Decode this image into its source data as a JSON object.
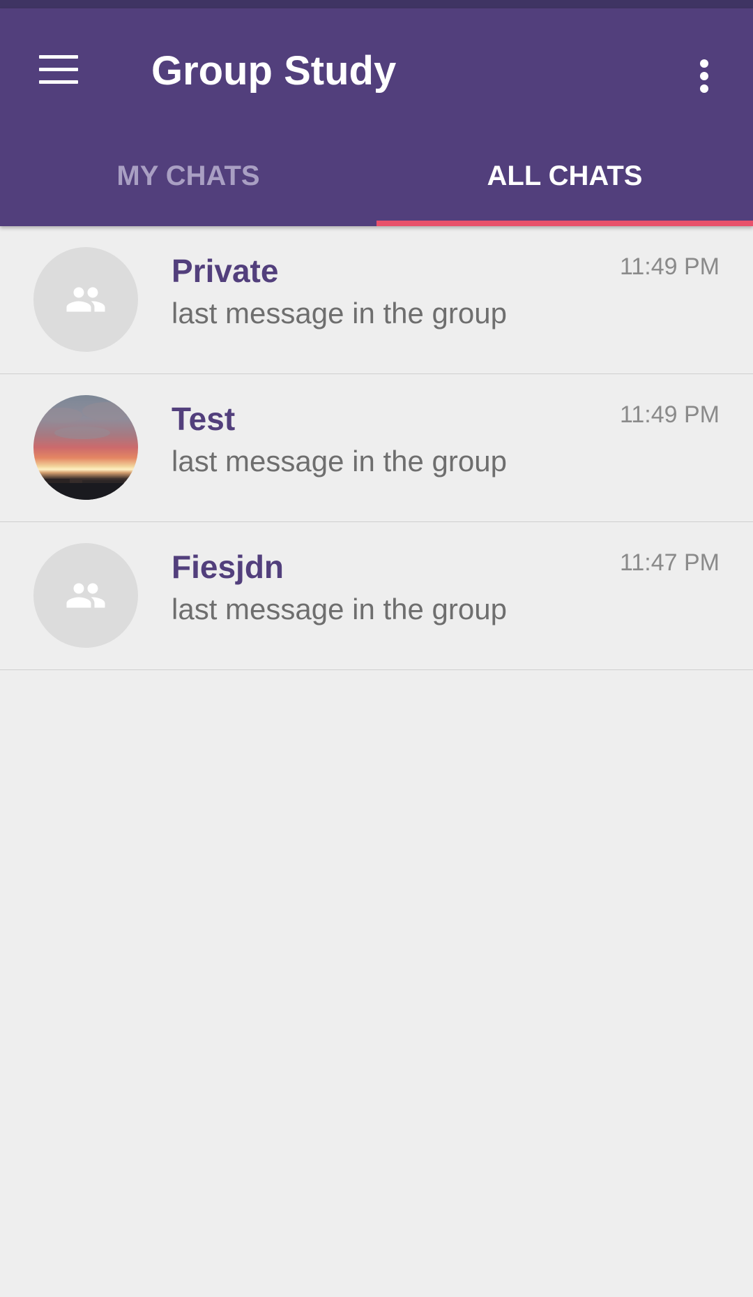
{
  "app": {
    "title": "Group Study",
    "colors": {
      "primary": "#523f7c",
      "status_bar": "#3f3463",
      "accent": "#e8516b",
      "background": "#eeeeee"
    },
    "icons": {
      "menu": "menu-icon",
      "more": "more-vert-icon",
      "group": "group-icon"
    }
  },
  "tabs": [
    {
      "label": "MY CHATS",
      "selected": false
    },
    {
      "label": "ALL CHATS",
      "selected": true
    }
  ],
  "chats": [
    {
      "name": "Private",
      "message": "last message in the group",
      "time": "11:49 PM",
      "avatar": "group-icon"
    },
    {
      "name": "Test",
      "message": "last message in the group",
      "time": "11:49 PM",
      "avatar": "photo"
    },
    {
      "name": "Fiesjdn",
      "message": "last message in the group",
      "time": "11:47 PM",
      "avatar": "group-icon"
    }
  ]
}
